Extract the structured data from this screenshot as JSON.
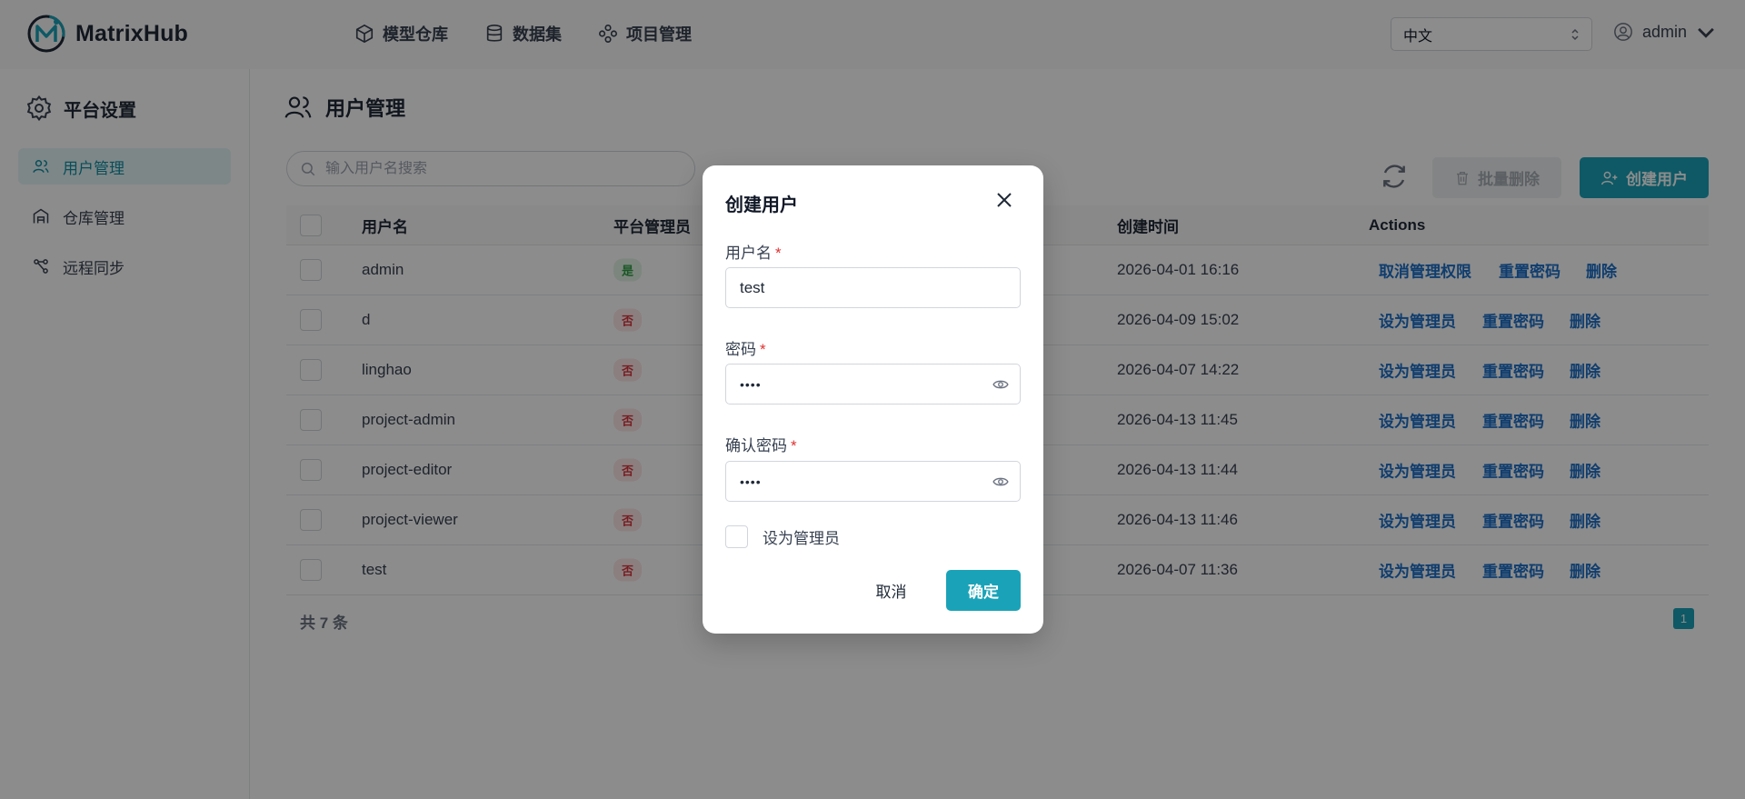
{
  "app": {
    "name": "MatrixHub"
  },
  "nav": [
    {
      "label": "模型仓库",
      "icon": "cube-icon"
    },
    {
      "label": "数据集",
      "icon": "database-icon"
    },
    {
      "label": "项目管理",
      "icon": "project-icon"
    }
  ],
  "header": {
    "language": "中文",
    "user": "admin"
  },
  "sidebar": {
    "title": "平台设置",
    "items": [
      {
        "label": "用户管理",
        "active": true
      },
      {
        "label": "仓库管理",
        "active": false
      },
      {
        "label": "远程同步",
        "active": false
      }
    ]
  },
  "main": {
    "title": "用户管理",
    "search_placeholder": "输入用户名搜索",
    "batch_delete": "批量删除",
    "create_user": "创建用户",
    "columns": [
      "用户名",
      "平台管理员",
      "创建时间",
      "Actions"
    ],
    "rows": [
      {
        "username": "admin",
        "is_admin": "是",
        "created": "2026-04-01 16:16",
        "actions": [
          "取消管理权限",
          "重置密码",
          "删除"
        ]
      },
      {
        "username": "d",
        "is_admin": "否",
        "created": "2026-04-09 15:02",
        "actions": [
          "设为管理员",
          "重置密码",
          "删除"
        ]
      },
      {
        "username": "linghao",
        "is_admin": "否",
        "created": "2026-04-07 14:22",
        "actions": [
          "设为管理员",
          "重置密码",
          "删除"
        ]
      },
      {
        "username": "project-admin",
        "is_admin": "否",
        "created": "2026-04-13 11:45",
        "actions": [
          "设为管理员",
          "重置密码",
          "删除"
        ]
      },
      {
        "username": "project-editor",
        "is_admin": "否",
        "created": "2026-04-13 11:44",
        "actions": [
          "设为管理员",
          "重置密码",
          "删除"
        ]
      },
      {
        "username": "project-viewer",
        "is_admin": "否",
        "created": "2026-04-13 11:46",
        "actions": [
          "设为管理员",
          "重置密码",
          "删除"
        ]
      },
      {
        "username": "test",
        "is_admin": "否",
        "created": "2026-04-07 11:36",
        "actions": [
          "设为管理员",
          "重置密码",
          "删除"
        ]
      }
    ],
    "total": "共 7 条",
    "page": "1"
  },
  "dialog": {
    "title": "创建用户",
    "username_label": "用户名",
    "username_value": "test",
    "password_label": "密码",
    "password_value": "••••",
    "confirm_label": "确认密码",
    "confirm_value": "••••",
    "required_mark": "*",
    "admin_checkbox": "设为管理员",
    "cancel": "取消",
    "ok": "确定"
  },
  "colors": {
    "accent": "#1aa3b8",
    "link": "#1d6fc9",
    "yes_badge": "#2f9e44",
    "no_badge": "#d9363e"
  }
}
